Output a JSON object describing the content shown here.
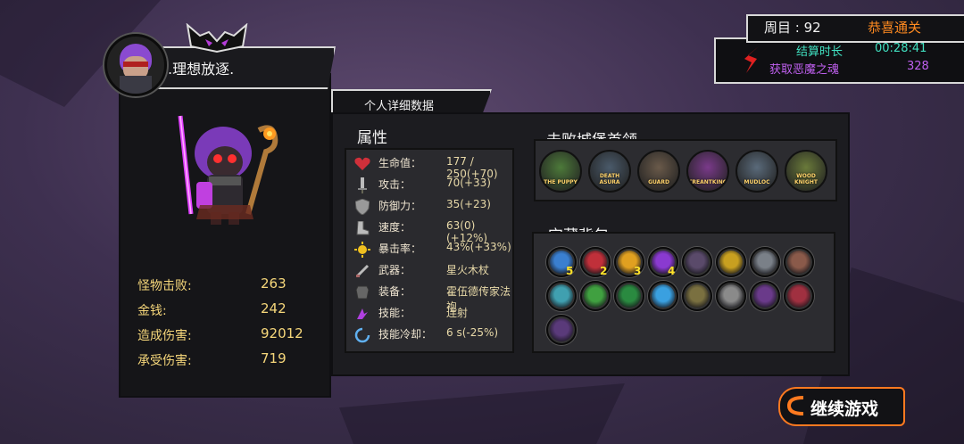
{
  "player": {
    "name": ".理想放逐."
  },
  "detail_tab": "个人详细数据",
  "attributes": {
    "title": "属性",
    "rows": [
      {
        "icon": "heart-icon",
        "label": "生命值：",
        "value": "177 / 250(+70)"
      },
      {
        "icon": "sword-icon",
        "label": "攻击：",
        "value": "70(+33)"
      },
      {
        "icon": "shield-icon",
        "label": "防御力：",
        "value": "35(+23)"
      },
      {
        "icon": "boot-icon",
        "label": "速度：",
        "value": "63(0)(+12%)"
      },
      {
        "icon": "crit-sun-icon",
        "label": "暴击率：",
        "value": "43%(+33%)"
      },
      {
        "icon": "weapon-icon",
        "label": "武器：",
        "value": "星火木杖"
      },
      {
        "icon": "armor-icon",
        "label": "装备：",
        "value": "霍伍德传家法袍"
      },
      {
        "icon": "skill-icon",
        "label": "技能：",
        "value": "连射"
      },
      {
        "icon": "cooldown-icon",
        "label": "技能冷却：",
        "value": "6 s(-25%)"
      }
    ]
  },
  "bosses": {
    "title": "击败城堡首领",
    "items": [
      {
        "name": "THE PUPPY",
        "color": "#4d7a3a"
      },
      {
        "name": "DEATH ASURA",
        "color": "#4a5a6a"
      },
      {
        "name": "GUARD",
        "color": "#6a5a4a"
      },
      {
        "name": "TREANTKING",
        "color": "#7a3a8a"
      },
      {
        "name": "MUDLOC",
        "color": "#5a6a7a"
      },
      {
        "name": "WOOD KNIGHT",
        "color": "#6a7a3a"
      }
    ]
  },
  "treasure": {
    "title": "宝藏背包",
    "items": [
      {
        "color": "#3a7fd0",
        "count": "5"
      },
      {
        "color": "#c0303a",
        "count": "2"
      },
      {
        "color": "#e0a020",
        "count": "3"
      },
      {
        "color": "#8a3ad0",
        "count": "4"
      },
      {
        "color": "#5a4a6a",
        "count": ""
      },
      {
        "color": "#c8a020",
        "count": ""
      },
      {
        "color": "#7a8088",
        "count": ""
      },
      {
        "color": "#8a5a4a",
        "count": ""
      },
      {
        "color": "#40a0b0",
        "count": ""
      },
      {
        "color": "#40a040",
        "count": ""
      },
      {
        "color": "#2a8a40",
        "count": ""
      },
      {
        "color": "#3aa0e0",
        "count": ""
      },
      {
        "color": "#7a7040",
        "count": ""
      },
      {
        "color": "#8a8a8a",
        "count": ""
      },
      {
        "color": "#6a3a8a",
        "count": ""
      },
      {
        "color": "#a03040",
        "count": ""
      },
      {
        "color": "#5a3a7a",
        "count": ""
      }
    ]
  },
  "stats": [
    {
      "label": "怪物击败:",
      "value": "263"
    },
    {
      "label": "金钱:",
      "value": "242"
    },
    {
      "label": "造成伤害:",
      "value": "92012"
    },
    {
      "label": "承受伤害:",
      "value": "719"
    }
  ],
  "summary": {
    "cycle_label": "周目 : 92",
    "congrats": "恭喜通关",
    "time_label": "结算时长",
    "time_value": "00:28:41",
    "souls_label": "获取恶魔之魂",
    "souls_value": "328"
  },
  "continue_button": "继续游戏"
}
